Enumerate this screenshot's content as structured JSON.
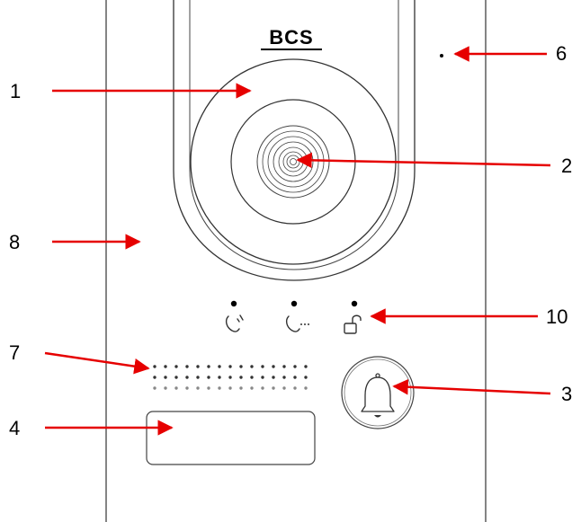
{
  "brand": {
    "logo_text": "BCS"
  },
  "callouts": [
    {
      "number": "1",
      "target": "camera-lens-ring"
    },
    {
      "number": "2",
      "target": "camera-lens"
    },
    {
      "number": "3",
      "target": "call-button"
    },
    {
      "number": "4",
      "target": "name-label-plate"
    },
    {
      "number": "6",
      "target": "microphone-hole"
    },
    {
      "number": "7",
      "target": "speaker-grille"
    },
    {
      "number": "8",
      "target": "front-panel"
    },
    {
      "number": "10",
      "target": "status-indicators"
    }
  ],
  "indicators": [
    {
      "icon": "calling-icon"
    },
    {
      "icon": "talking-icon"
    },
    {
      "icon": "unlock-icon"
    }
  ],
  "colors": {
    "arrow": "#e60000",
    "outline": "#333333",
    "panel": "#ffffff"
  }
}
